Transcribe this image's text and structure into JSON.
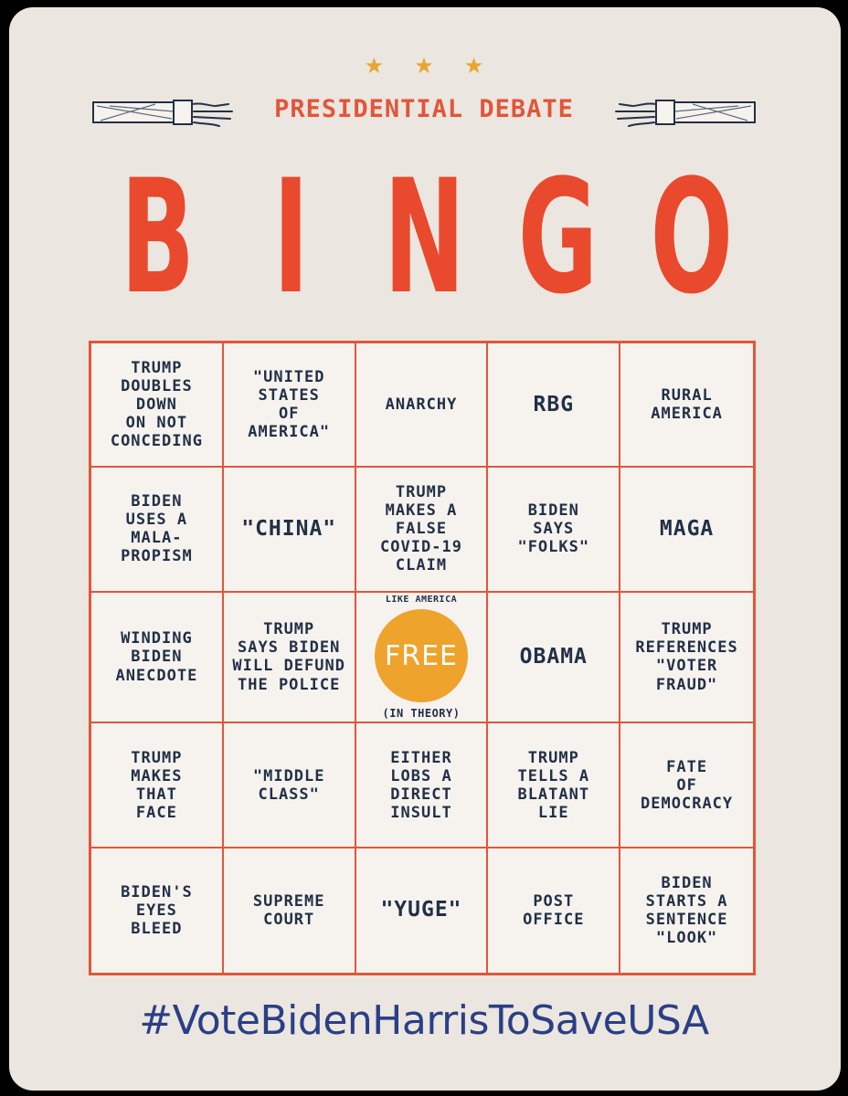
{
  "header": {
    "stars": [
      "★",
      "★",
      "★"
    ],
    "subtitle": "PRESIDENTIAL DEBATE",
    "title_letters": [
      "B",
      "I",
      "N",
      "G",
      "O"
    ]
  },
  "grid": {
    "cells": [
      "TRUMP\nDOUBLES\nDOWN\nON NOT\nCONCEDING",
      "\"UNITED\nSTATES\nOF\nAMERICA\"",
      "ANARCHY",
      "RBG",
      "RURAL\nAMERICA",
      "BIDEN\nUSES A\nMALA-\nPROPISM",
      "\"CHINA\"",
      "TRUMP\nMAKES A\nFALSE\nCOVID-19\nCLAIM",
      "BIDEN\nSAYS\n\"FOLKS\"",
      "MAGA",
      "WINDING\nBIDEN\nANECDOTE",
      "TRUMP\nSAYS BIDEN\nWILL DEFUND\nTHE POLICE",
      "",
      "OBAMA",
      "TRUMP\nREFERENCES\n\"VOTER\nFRAUD\"",
      "TRUMP\nMAKES\nTHAT\nFACE",
      "\"MIDDLE\nCLASS\"",
      "EITHER\nLOBS A\nDIRECT\nINSULT",
      "TRUMP\nTELLS A\nBLATANT\nLIE",
      "FATE\nOF\nDEMOCRACY",
      "BIDEN'S\nEYES\nBLEED",
      "SUPREME\nCOURT",
      "\"YUGE\"",
      "POST\nOFFICE",
      "BIDEN\nSTARTS A\nSENTENCE\n\"LOOK\""
    ],
    "free": {
      "top": "LIKE AMERICA",
      "label": "FREE",
      "bottom": "(IN THEORY)"
    }
  },
  "footer": {
    "hashtag": "#VoteBidenHarrisToSaveUSA"
  },
  "colors": {
    "background": "#ebe6df",
    "accent_red": "#e9492d",
    "grid_line": "#e2553a",
    "free_circle": "#eea32d",
    "text_navy": "#223047",
    "hashtag": "#2b3f86"
  }
}
